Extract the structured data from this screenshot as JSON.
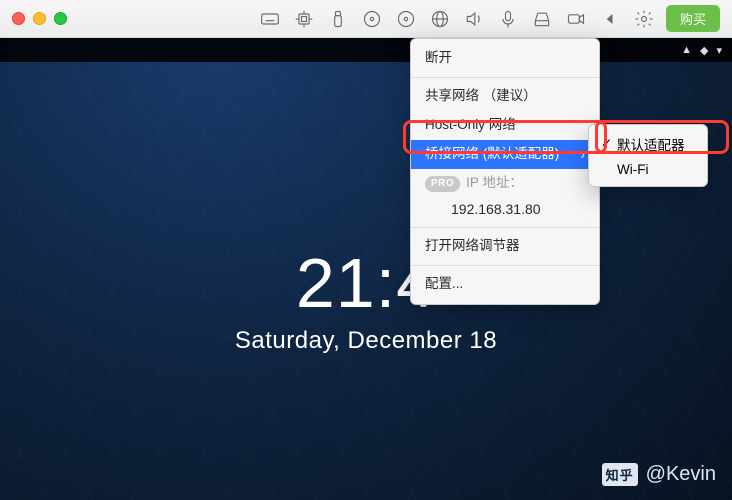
{
  "titlebar": {
    "buy_label": "购买"
  },
  "vm": {
    "clock_time": "21:4",
    "clock_date": "Saturday, December 18"
  },
  "network_menu": {
    "disconnect": "断开",
    "shared_label": "共享网络 （建议）",
    "host_only_label": "Host-Only 网络",
    "bridged_label": "桥接网络 (默认适配器)",
    "pro_badge": "PRO",
    "ip_label": "IP 地址：",
    "ip_value": "192.168.31.80",
    "open_tuner": "打开网络调节器",
    "configure": "配置..."
  },
  "submenu": {
    "default_adapter": "默认适配器",
    "wifi": "Wi-Fi"
  },
  "watermark": {
    "logo": "知乎",
    "author": "@Kevin"
  }
}
